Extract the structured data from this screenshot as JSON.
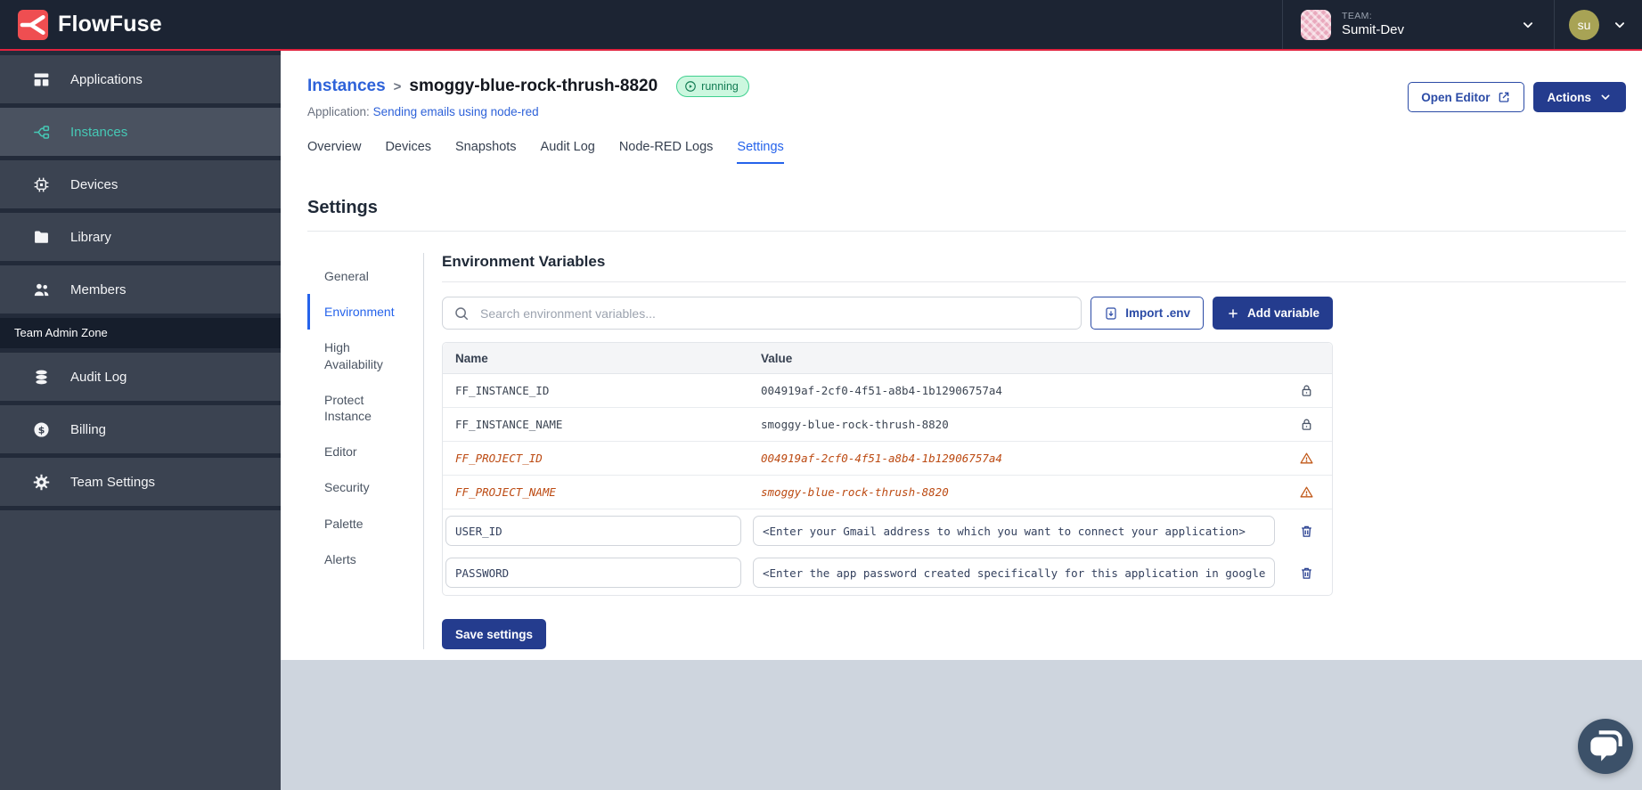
{
  "brand": {
    "name": "FlowFuse"
  },
  "topbar": {
    "team_label": "TEAM:",
    "team_name": "Sumit-Dev",
    "user_initials": "su"
  },
  "sidebar": {
    "items": [
      {
        "label": "Applications",
        "icon": "applications-icon",
        "active": false
      },
      {
        "label": "Instances",
        "icon": "instances-icon",
        "active": true
      },
      {
        "label": "Devices",
        "icon": "devices-icon",
        "active": false
      },
      {
        "label": "Library",
        "icon": "library-icon",
        "active": false
      },
      {
        "label": "Members",
        "icon": "members-icon",
        "active": false
      }
    ],
    "admin_zone_label": "Team Admin Zone",
    "admin_items": [
      {
        "label": "Audit Log",
        "icon": "audit-log-icon"
      },
      {
        "label": "Billing",
        "icon": "billing-icon"
      },
      {
        "label": "Team Settings",
        "icon": "gear-icon"
      }
    ]
  },
  "header": {
    "breadcrumb_parent": "Instances",
    "breadcrumb_separator": ">",
    "instance_name": "smoggy-blue-rock-thrush-8820",
    "status": "running",
    "application_label": "Application:",
    "application_name": "Sending emails using node-red",
    "open_editor_label": "Open Editor",
    "actions_label": "Actions"
  },
  "tabs": [
    {
      "label": "Overview",
      "active": false
    },
    {
      "label": "Devices",
      "active": false
    },
    {
      "label": "Snapshots",
      "active": false
    },
    {
      "label": "Audit Log",
      "active": false
    },
    {
      "label": "Node-RED Logs",
      "active": false
    },
    {
      "label": "Settings",
      "active": true
    }
  ],
  "settings": {
    "title": "Settings",
    "nav": [
      {
        "label": "General",
        "active": false
      },
      {
        "label": "Environment",
        "active": true
      },
      {
        "label": "High Availability",
        "active": false
      },
      {
        "label": "Protect Instance",
        "active": false
      },
      {
        "label": "Editor",
        "active": false
      },
      {
        "label": "Security",
        "active": false
      },
      {
        "label": "Palette",
        "active": false
      },
      {
        "label": "Alerts",
        "active": false
      }
    ]
  },
  "env": {
    "title": "Environment Variables",
    "search_placeholder": "Search environment variables...",
    "import_label": "Import .env",
    "add_label": "Add variable",
    "columns": [
      "Name",
      "Value"
    ],
    "rows": [
      {
        "name": "FF_INSTANCE_ID",
        "value": "004919af-2cf0-4f51-a8b4-1b12906757a4",
        "state": "locked"
      },
      {
        "name": "FF_INSTANCE_NAME",
        "value": "smoggy-blue-rock-thrush-8820",
        "state": "locked"
      },
      {
        "name": "FF_PROJECT_ID",
        "value": "004919af-2cf0-4f51-a8b4-1b12906757a4",
        "state": "deprecated"
      },
      {
        "name": "FF_PROJECT_NAME",
        "value": "smoggy-blue-rock-thrush-8820",
        "state": "deprecated"
      },
      {
        "name": "USER_ID",
        "value": "<Enter your Gmail address to which you want to connect your application>",
        "state": "editable"
      },
      {
        "name": "PASSWORD",
        "value": "<Enter the app password created specifically for this application in google",
        "state": "editable"
      }
    ],
    "save_label": "Save settings"
  },
  "colors": {
    "brand_red": "#ef4e51",
    "accent_red_line": "#e2223e",
    "sidebar_teal": "#46c8b5",
    "primary_navy": "#243c8e",
    "link_blue": "#2e62d9",
    "tab_active_blue": "#2563eb",
    "deprecated_orange": "#bc4a12",
    "status_green_text": "#147d54",
    "status_green_bg": "#ccf7df"
  }
}
